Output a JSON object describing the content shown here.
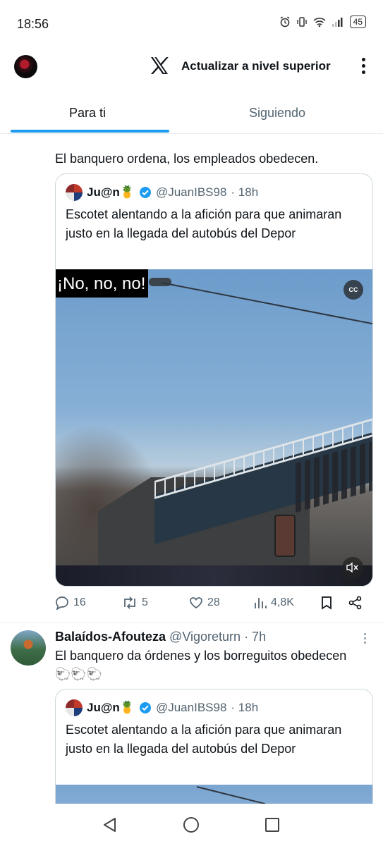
{
  "status_bar": {
    "time": "18:56",
    "battery": "45"
  },
  "header": {
    "upgrade_label": "Actualizar a nivel superior",
    "logo": "x-logo-icon"
  },
  "tabs": [
    {
      "label": "Para ti",
      "active": true
    },
    {
      "label": "Siguiendo",
      "active": false
    }
  ],
  "feed": {
    "tweet1": {
      "text": "El banquero ordena, los empleados obedecen.",
      "quote": {
        "name": "Ju@n🍍",
        "handle": "@JuanIBS98",
        "time": "· 18h",
        "text": "Escotet alentando a la afición para que animaran justo en la llegada del autobús del Depor",
        "video_caption": "¡No, no, no!",
        "cc_label": "CC"
      },
      "actions": {
        "replies": "16",
        "retweets": "5",
        "likes": "28",
        "views": "4,8K"
      }
    },
    "tweet2": {
      "name": "Balaídos-Afouteza",
      "handle": "@Vigoreturn",
      "time": "· 7h",
      "text": "El banquero da órdenes y los borreguitos obedecen 🐑🐑🐑",
      "quote": {
        "name": "Ju@n🍍",
        "handle": "@JuanIBS98",
        "time": "· 18h",
        "text": "Escotet alentando a la afición para que animaran justo en la llegada del autobús del Depor"
      }
    }
  },
  "colors": {
    "accent": "#1d9bf0",
    "text_primary": "#0f1419",
    "text_secondary": "#536471",
    "border": "#cfd9de",
    "verified": "#1d9bf0"
  }
}
